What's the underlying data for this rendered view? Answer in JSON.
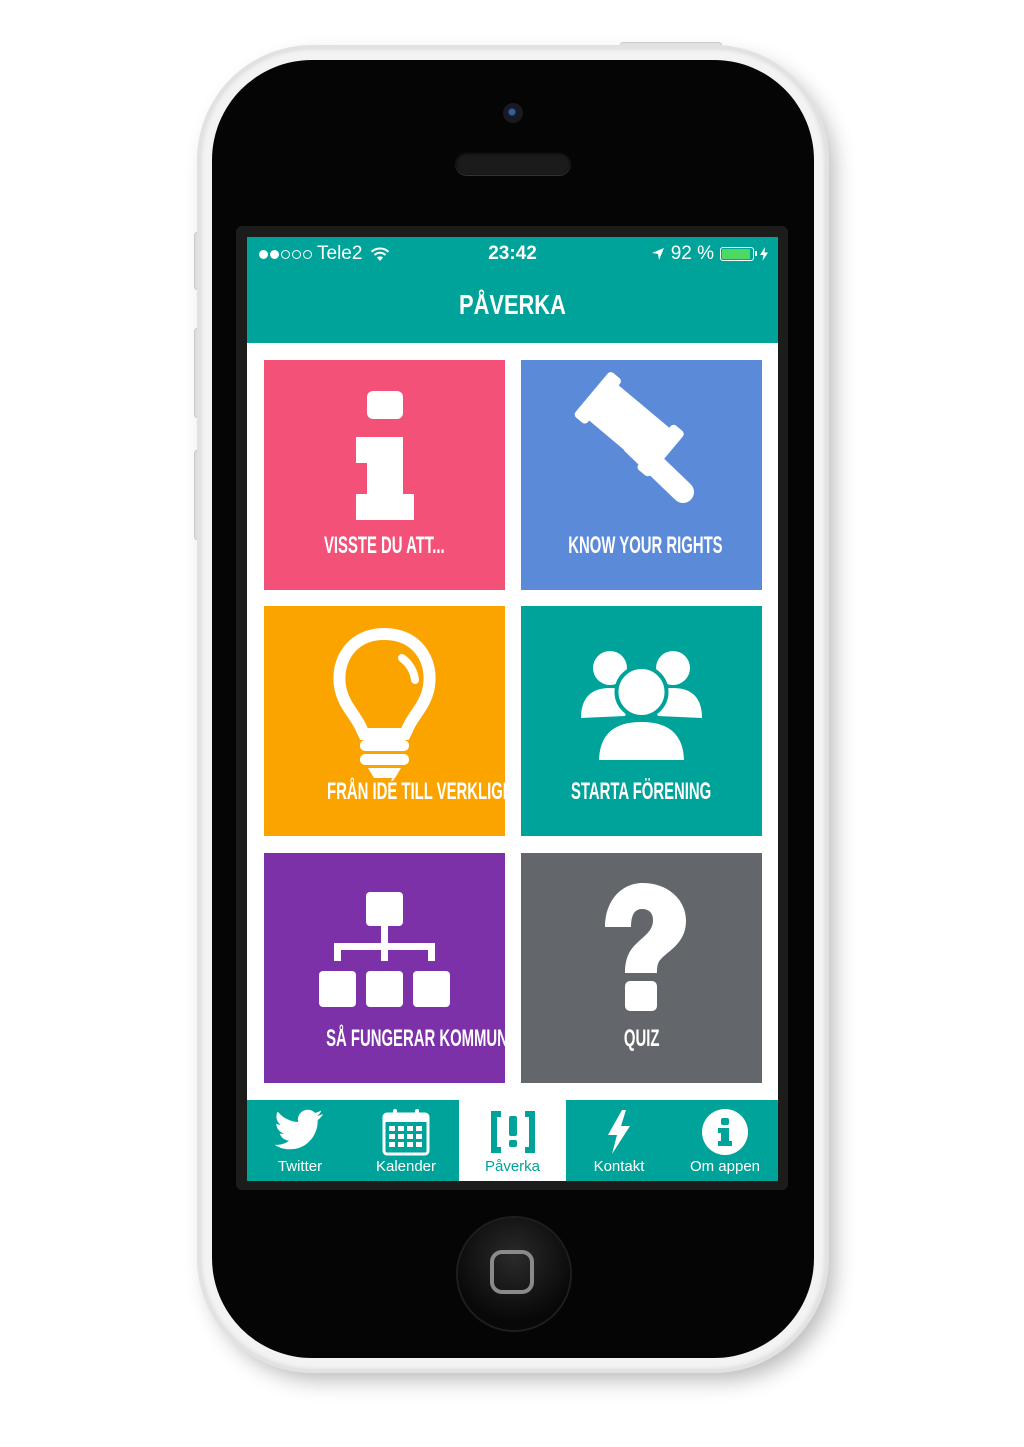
{
  "status_bar": {
    "carrier": "Tele2",
    "time": "23:42",
    "battery": "92 %"
  },
  "nav": {
    "title": "PÅVERKA"
  },
  "tiles": [
    {
      "label": "VISSTE DU ATT...",
      "icon": "info-icon",
      "color": "#f45178"
    },
    {
      "label": "KNOW YOUR RIGHTS",
      "icon": "gavel-icon",
      "color": "#5a8ad8"
    },
    {
      "label": "FRÅN IDÉ TILL VERKLIGHET",
      "icon": "lightbulb-icon",
      "color": "#fba400"
    },
    {
      "label": "STARTA FÖRENING",
      "icon": "group-icon",
      "color": "#00a39a"
    },
    {
      "label": "SÅ FUNGERAR KOMMUNEN",
      "icon": "org-chart-icon",
      "color": "#7d31a9"
    },
    {
      "label": "QUIZ",
      "icon": "question-icon",
      "color": "#63666b"
    }
  ],
  "tabbar": {
    "items": [
      {
        "label": "Twitter",
        "icon": "twitter-icon"
      },
      {
        "label": "Kalender",
        "icon": "calendar-icon"
      },
      {
        "label": "Påverka",
        "icon": "paverka-icon",
        "active": true
      },
      {
        "label": "Kontakt",
        "icon": "lightning-icon"
      },
      {
        "label": "Om appen",
        "icon": "info-circle-icon"
      }
    ]
  },
  "colors": {
    "accent": "#00a39a"
  }
}
